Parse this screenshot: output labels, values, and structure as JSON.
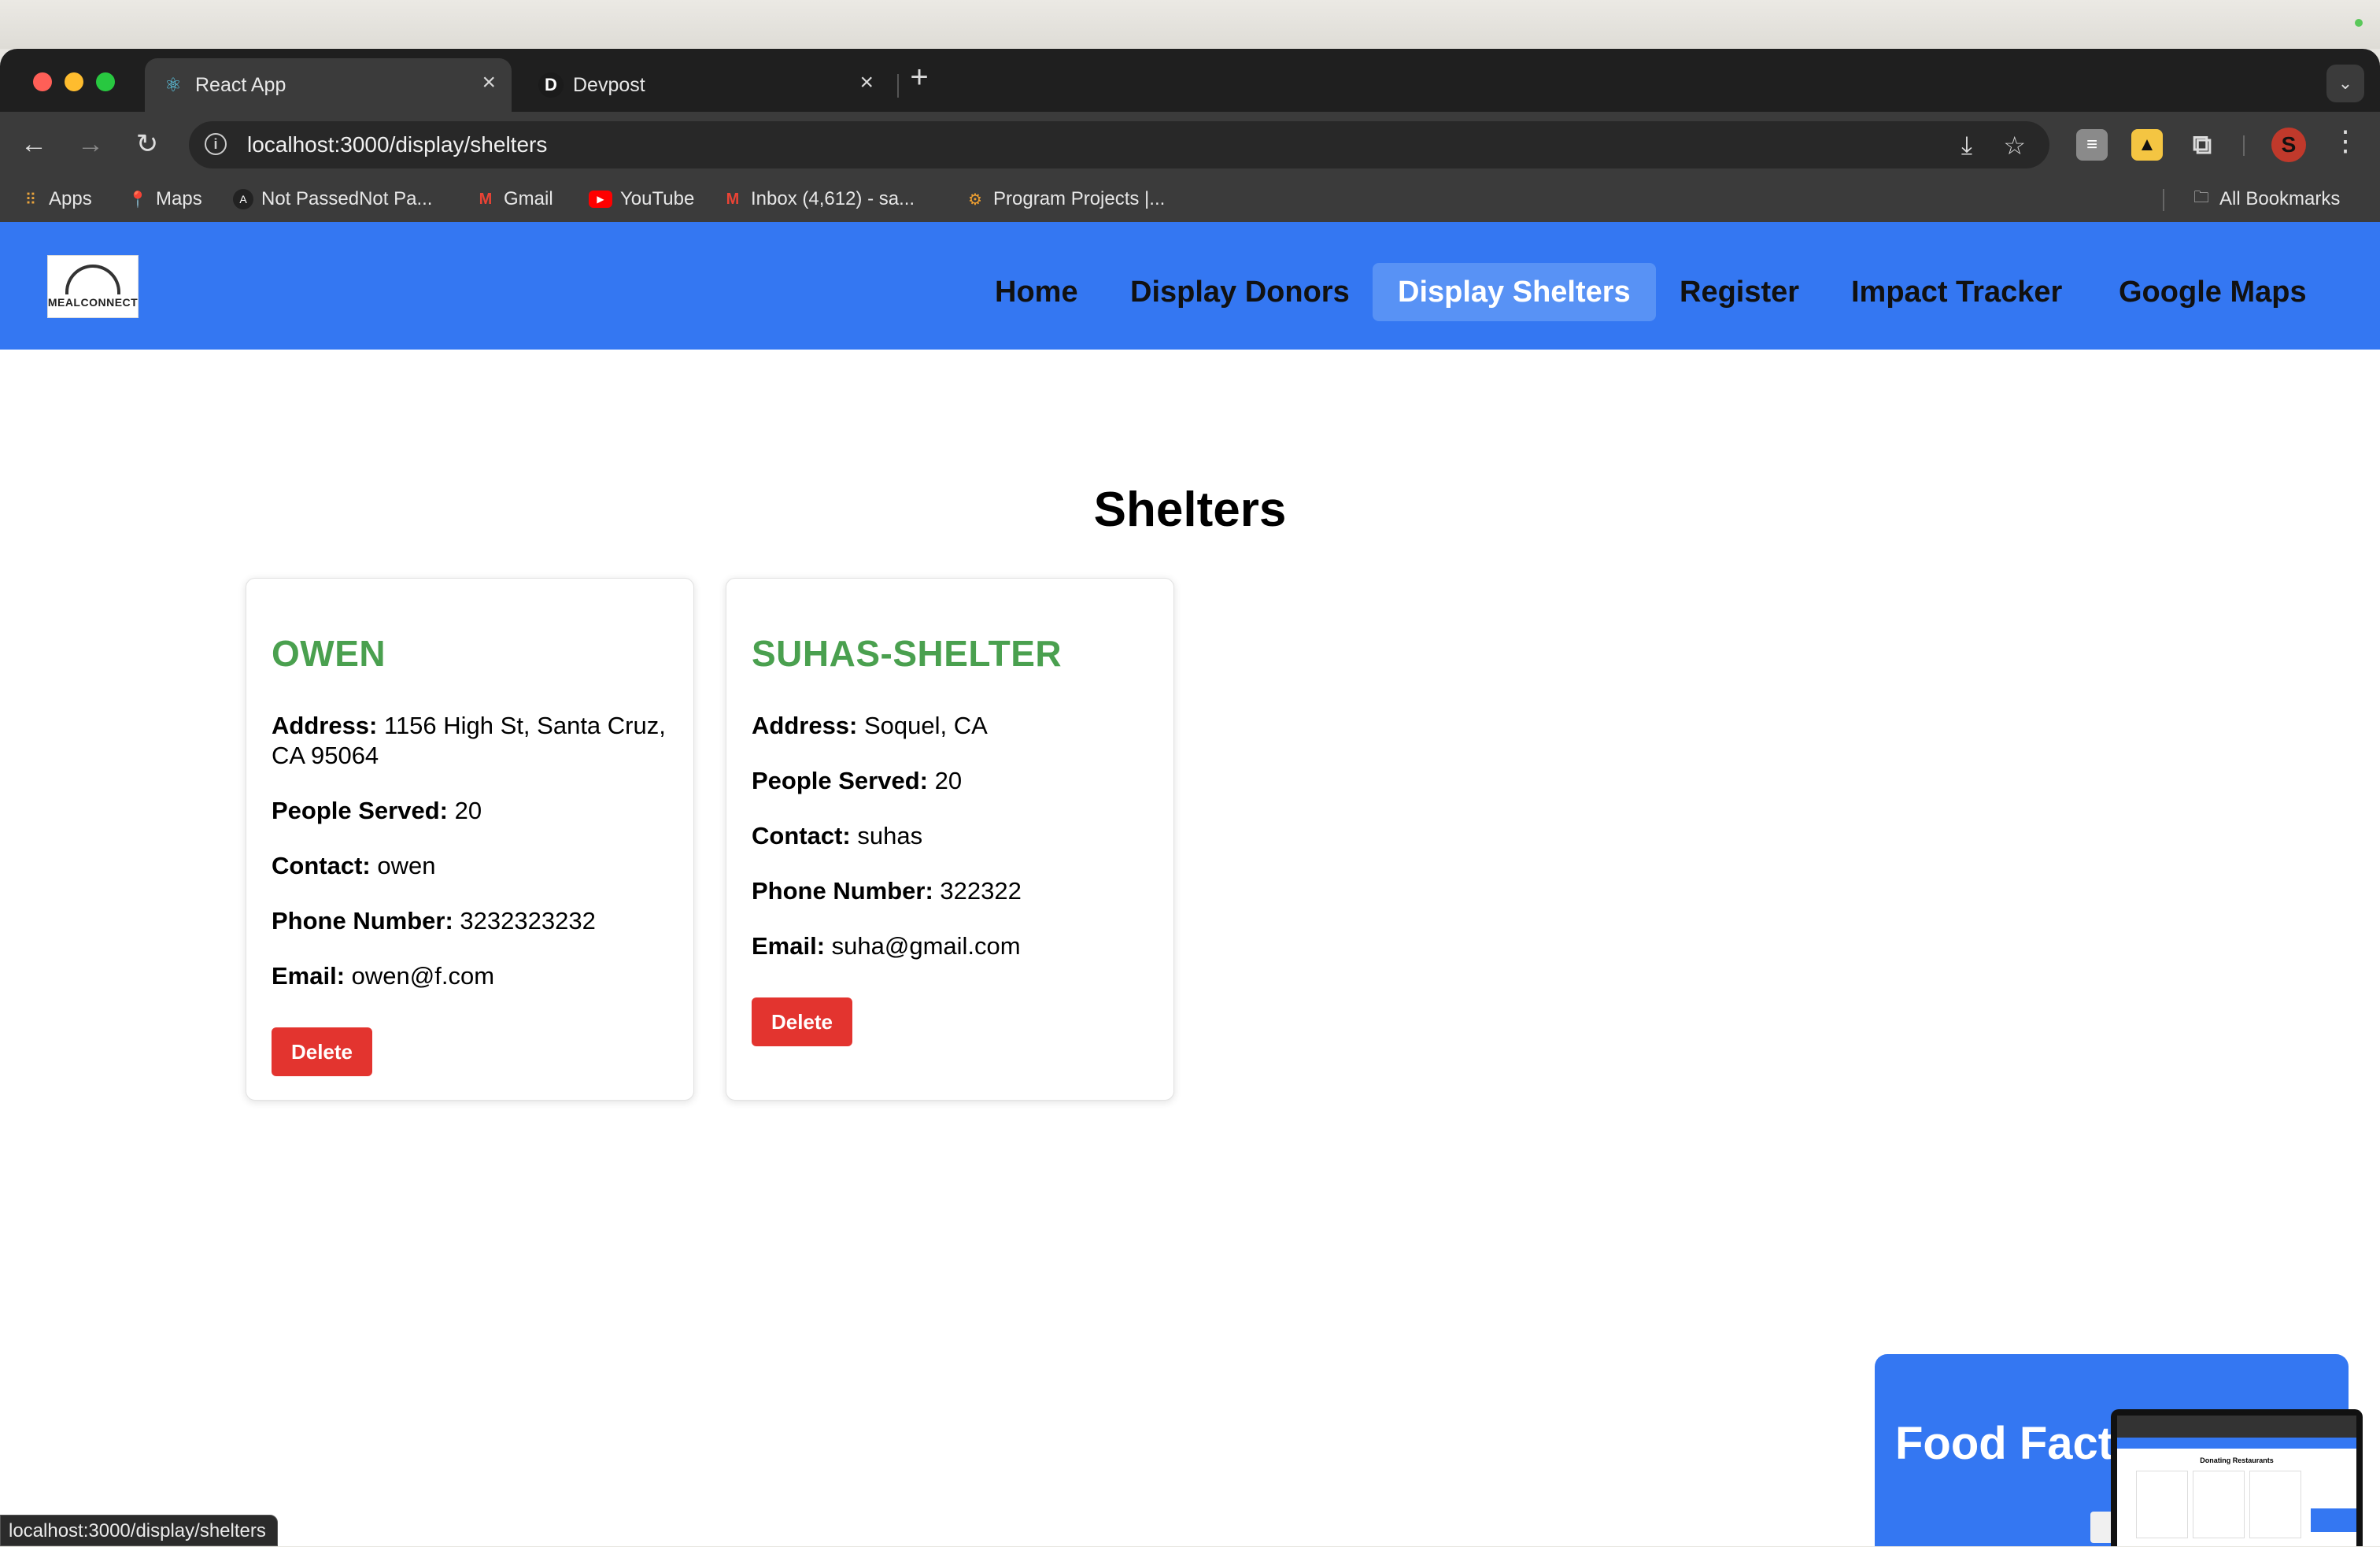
{
  "browser": {
    "tabs": [
      {
        "title": "React App",
        "icon": "react-icon",
        "active": true
      },
      {
        "title": "Devpost",
        "icon": "devpost-icon",
        "active": false,
        "icon_letter": "D"
      }
    ],
    "url": "localhost:3000/display/shelters",
    "bookmarks": [
      {
        "label": "Apps",
        "icon": "apps-grid-icon"
      },
      {
        "label": "Maps",
        "icon": "maps-pin-icon"
      },
      {
        "label": "Not PassedNot Pa...",
        "icon": "anthropic-icon"
      },
      {
        "label": "Gmail",
        "icon": "gmail-icon"
      },
      {
        "label": "YouTube",
        "icon": "youtube-icon"
      },
      {
        "label": "Inbox (4,612) - sa...",
        "icon": "gmail-icon"
      },
      {
        "label": "Program Projects |...",
        "icon": "gear-icon"
      }
    ],
    "all_bookmarks": "All Bookmarks",
    "status_url": "localhost:3000/display/shelters",
    "profile_initial": "S"
  },
  "app": {
    "logo_text": "MEALCONNECT",
    "nav": [
      {
        "label": "Home",
        "active": false
      },
      {
        "label": "Display Donors",
        "active": false
      },
      {
        "label": "Display Shelters",
        "active": true
      },
      {
        "label": "Register",
        "active": false
      },
      {
        "label": "Impact Tracker",
        "active": false
      },
      {
        "label": "Google Maps",
        "active": false
      }
    ],
    "heading": "Shelters",
    "labels": {
      "address": "Address:",
      "people_served": "People Served:",
      "contact": "Contact:",
      "phone": "Phone Number:",
      "email": "Email:"
    },
    "shelters": [
      {
        "name": "OWEN",
        "address": "1156 High St, Santa Cruz, CA 95064",
        "people_served": "20",
        "contact": "owen",
        "phone": "3232323232",
        "email": "owen@f.com",
        "delete_label": "Delete"
      },
      {
        "name": "SUHAS-SHELTER",
        "address": "Soquel, CA",
        "people_served": "20",
        "contact": "suhas",
        "phone": "322322",
        "email": "suha@gmail.com",
        "delete_label": "Delete"
      }
    ],
    "widget": {
      "title": "Food Fact"
    },
    "pip": {
      "heading": "Donating Restaurants"
    }
  },
  "colors": {
    "nav_blue": "#3477f2",
    "shelter_green": "#4aa04f",
    "delete_red": "#e3342f"
  }
}
